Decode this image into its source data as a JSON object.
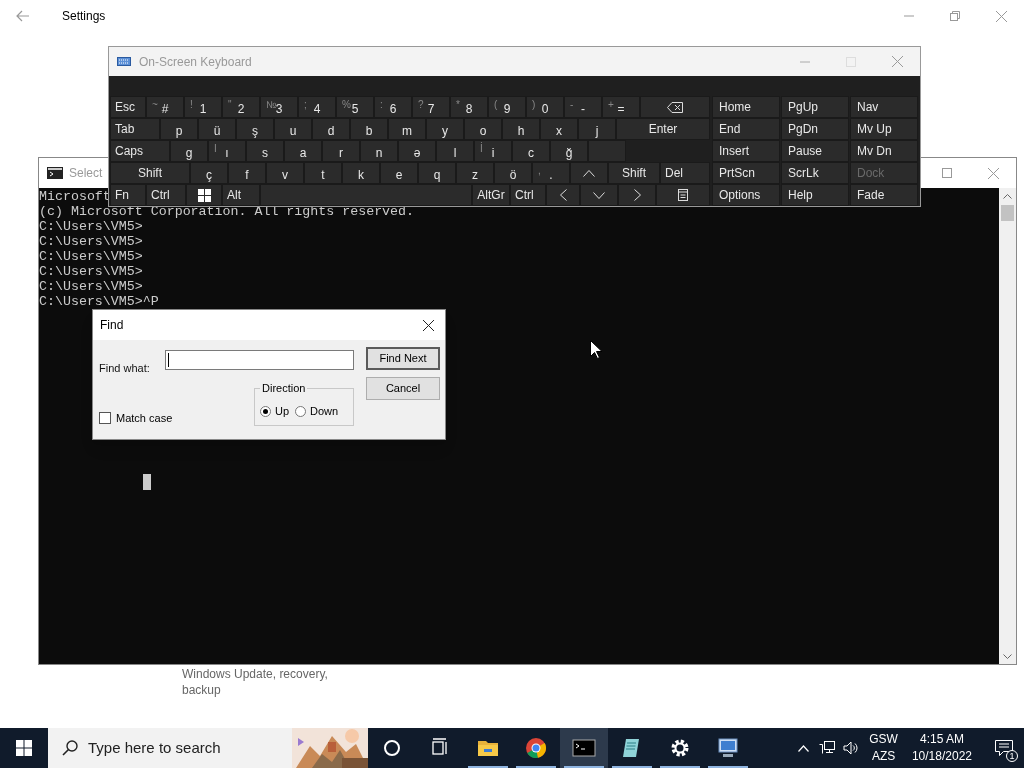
{
  "settings_window": {
    "title": "Settings",
    "description": "Windows Update, recovery, backup"
  },
  "console": {
    "title": "Select",
    "lines": [
      "Microsoft",
      "(c) Microsoft Corporation. All rights reserved.",
      "C:\\Users\\VM5>",
      "C:\\Users\\VM5>",
      "C:\\Users\\VM5>",
      "C:\\Users\\VM5>",
      "C:\\Users\\VM5>",
      "C:\\Users\\VM5>^P"
    ]
  },
  "keyboard": {
    "title": "On-Screen Keyboard",
    "rows": [
      [
        {
          "kind": "key",
          "label": "Esc"
        },
        {
          "kind": "key",
          "shift": "~",
          "label": "#"
        },
        {
          "kind": "key",
          "shift": "!",
          "label": "1"
        },
        {
          "kind": "key",
          "shift": "\"",
          "label": "2"
        },
        {
          "kind": "key",
          "shift": "№",
          "label": "3"
        },
        {
          "kind": "key",
          "shift": ";",
          "label": "4"
        },
        {
          "kind": "key",
          "shift": "%",
          "label": "5"
        },
        {
          "kind": "key",
          "shift": ":",
          "label": "6"
        },
        {
          "kind": "key",
          "shift": "?",
          "label": "7"
        },
        {
          "kind": "key",
          "shift": "*",
          "label": "8"
        },
        {
          "kind": "key",
          "shift": "(",
          "label": "9"
        },
        {
          "kind": "key",
          "shift": ")",
          "label": "0"
        },
        {
          "kind": "key",
          "shift": "-",
          "label": "-"
        },
        {
          "kind": "key",
          "shift": "+",
          "label": "="
        },
        {
          "kind": "backspace"
        }
      ],
      [
        {
          "kind": "key",
          "label": "Tab"
        },
        {
          "kind": "key",
          "label": "p"
        },
        {
          "kind": "key",
          "label": "ü"
        },
        {
          "kind": "key",
          "label": "ş"
        },
        {
          "kind": "key",
          "label": "u"
        },
        {
          "kind": "key",
          "label": "d"
        },
        {
          "kind": "key",
          "label": "b"
        },
        {
          "kind": "key",
          "label": "m"
        },
        {
          "kind": "key",
          "label": "y"
        },
        {
          "kind": "key",
          "label": "o"
        },
        {
          "kind": "key",
          "label": "h"
        },
        {
          "kind": "key",
          "label": "x"
        },
        {
          "kind": "key",
          "label": "j"
        },
        {
          "kind": "key",
          "label": "Enter"
        }
      ],
      [
        {
          "kind": "key",
          "label": "Caps"
        },
        {
          "kind": "key",
          "label": "g"
        },
        {
          "kind": "key",
          "shift": "I",
          "label": "ı"
        },
        {
          "kind": "key",
          "label": "s"
        },
        {
          "kind": "key",
          "label": "a"
        },
        {
          "kind": "key",
          "label": "r"
        },
        {
          "kind": "key",
          "label": "n"
        },
        {
          "kind": "key",
          "label": "ə"
        },
        {
          "kind": "key",
          "label": "l"
        },
        {
          "kind": "key",
          "shift": "İ",
          "label": "i"
        },
        {
          "kind": "key",
          "label": "c"
        },
        {
          "kind": "key",
          "label": "ğ"
        },
        {
          "kind": "blank"
        }
      ],
      [
        {
          "kind": "key",
          "label": "Shift"
        },
        {
          "kind": "key",
          "label": "ç"
        },
        {
          "kind": "key",
          "label": "f"
        },
        {
          "kind": "key",
          "label": "v"
        },
        {
          "kind": "key",
          "label": "t"
        },
        {
          "kind": "key",
          "label": "k"
        },
        {
          "kind": "key",
          "label": "e"
        },
        {
          "kind": "key",
          "label": "q"
        },
        {
          "kind": "key",
          "label": "z"
        },
        {
          "kind": "key",
          "label": "ö"
        },
        {
          "kind": "key",
          "shift": ",",
          "label": "."
        },
        {
          "kind": "up"
        },
        {
          "kind": "key",
          "label": "Shift"
        },
        {
          "kind": "key",
          "label": "Del"
        }
      ],
      [
        {
          "kind": "key",
          "label": "Fn"
        },
        {
          "kind": "key",
          "label": "Ctrl"
        },
        {
          "kind": "windows"
        },
        {
          "kind": "key",
          "label": "Alt"
        },
        {
          "kind": "blank"
        },
        {
          "kind": "key",
          "label": "AltGr"
        },
        {
          "kind": "key",
          "label": "Ctrl"
        },
        {
          "kind": "left"
        },
        {
          "kind": "down"
        },
        {
          "kind": "right"
        },
        {
          "kind": "menu"
        }
      ]
    ],
    "nav": [
      {
        "label": "Home",
        "disabled": false
      },
      {
        "label": "PgUp",
        "disabled": false
      },
      {
        "label": "Nav",
        "disabled": false
      },
      {
        "label": "End",
        "disabled": false
      },
      {
        "label": "PgDn",
        "disabled": false
      },
      {
        "label": "Mv Up",
        "disabled": false
      },
      {
        "label": "Insert",
        "disabled": false
      },
      {
        "label": "Pause",
        "disabled": false
      },
      {
        "label": "Mv Dn",
        "disabled": false
      },
      {
        "label": "PrtScn",
        "disabled": false
      },
      {
        "label": "ScrLk",
        "disabled": false
      },
      {
        "label": "Dock",
        "disabled": true
      },
      {
        "label": "Options",
        "disabled": false
      },
      {
        "label": "Help",
        "disabled": false
      },
      {
        "label": "Fade",
        "disabled": false
      }
    ]
  },
  "find_dialog": {
    "title": "Find",
    "find_what": {
      "label": "Find what:"
    },
    "buttons": [
      {
        "label": "Find Next",
        "default": true
      },
      {
        "label": "Cancel",
        "default": false
      }
    ],
    "direction": {
      "label": "Direction",
      "options": [
        {
          "label": "Up",
          "selected": true
        },
        {
          "label": "Down",
          "selected": false
        }
      ]
    },
    "match_case": {
      "label": "Match case",
      "checked": false
    }
  },
  "taskbar": {
    "search": {
      "placeholder": "Type here to search"
    },
    "apps": [
      {
        "kind": "circle",
        "running": false,
        "selected": false
      },
      {
        "kind": "taskview",
        "running": false,
        "selected": false
      },
      {
        "kind": "folder",
        "running": true,
        "selected": false
      },
      {
        "kind": "browser",
        "running": true,
        "selected": false
      },
      {
        "kind": "terminal",
        "running": true,
        "selected": true
      },
      {
        "kind": "notepad",
        "running": true,
        "selected": false
      },
      {
        "kind": "gear",
        "running": true,
        "selected": false
      },
      {
        "kind": "remote",
        "running": true,
        "selected": false
      }
    ],
    "language": [
      "GSW",
      "AZS"
    ],
    "time": "4:15 AM",
    "date": "10/18/2022",
    "notifications": "1"
  }
}
